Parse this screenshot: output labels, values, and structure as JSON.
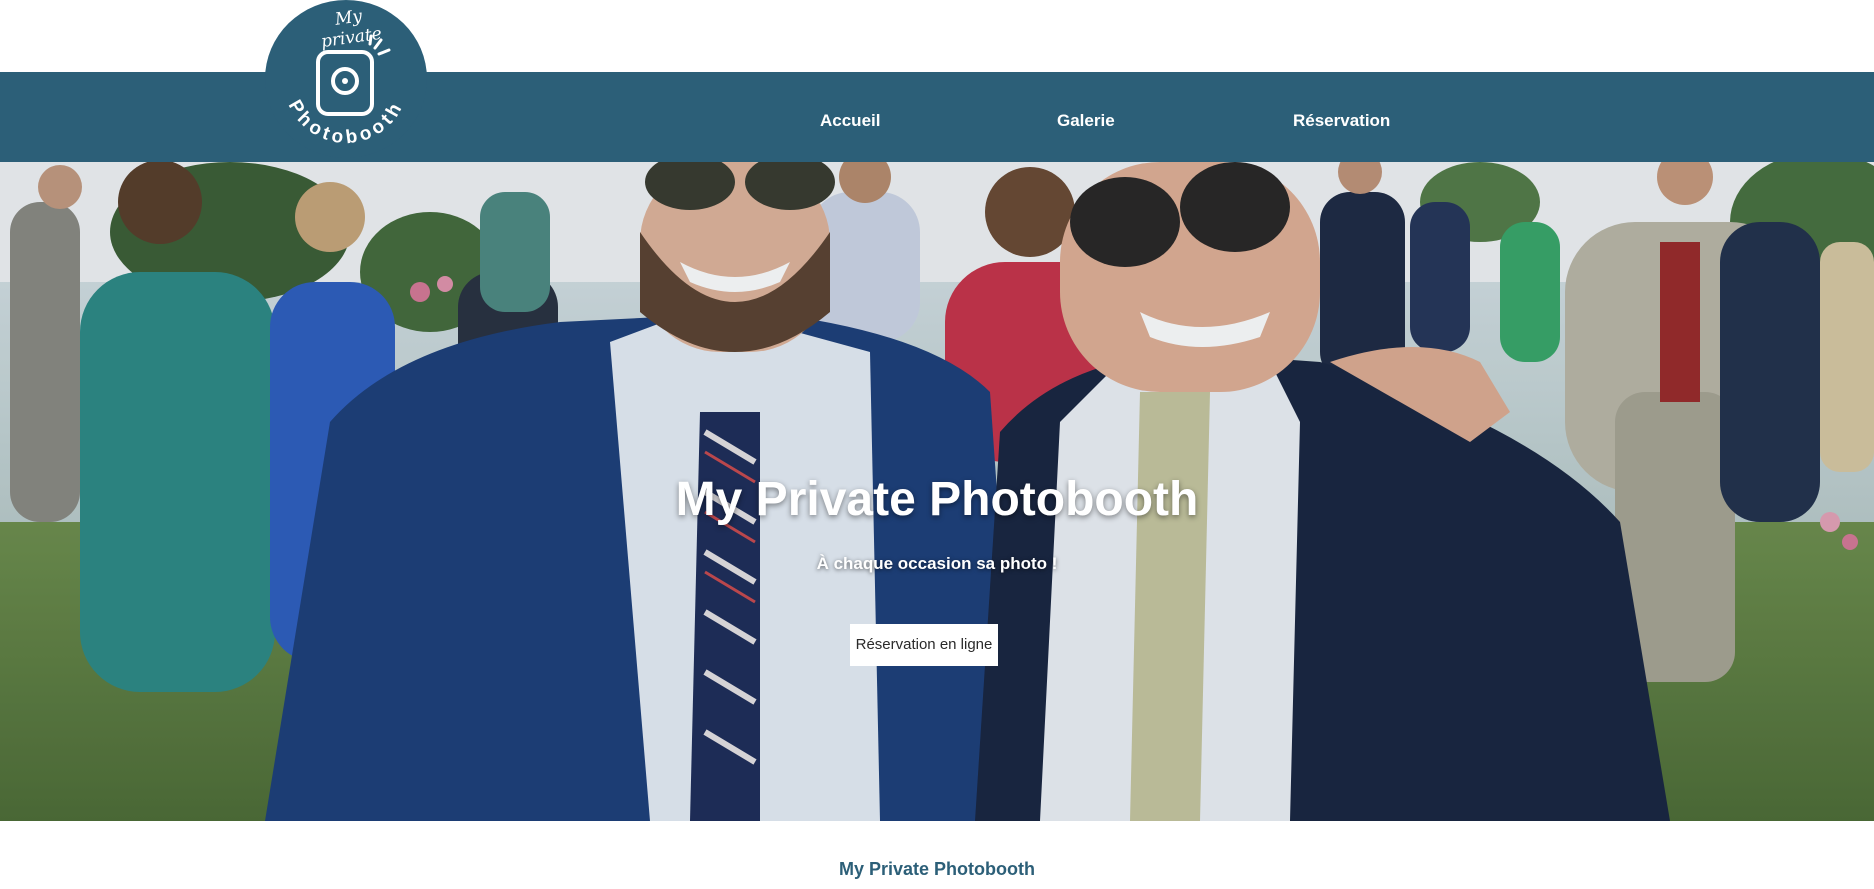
{
  "logo": {
    "script_text": "My private",
    "arc_text": "Photobooth",
    "icon": "camera-icon"
  },
  "nav": {
    "items": [
      {
        "label": "Accueil"
      },
      {
        "label": "Galerie"
      },
      {
        "label": "Réservation"
      }
    ]
  },
  "hero": {
    "title": "My Private Photobooth",
    "subtitle": "À chaque occasion sa photo !",
    "cta_label": "Réservation en ligne"
  },
  "footer": {
    "title": "My Private Photobooth"
  },
  "colors": {
    "brand": "#2c5f78",
    "hero_text": "#ffffff",
    "cta_background": "#ffffff"
  }
}
